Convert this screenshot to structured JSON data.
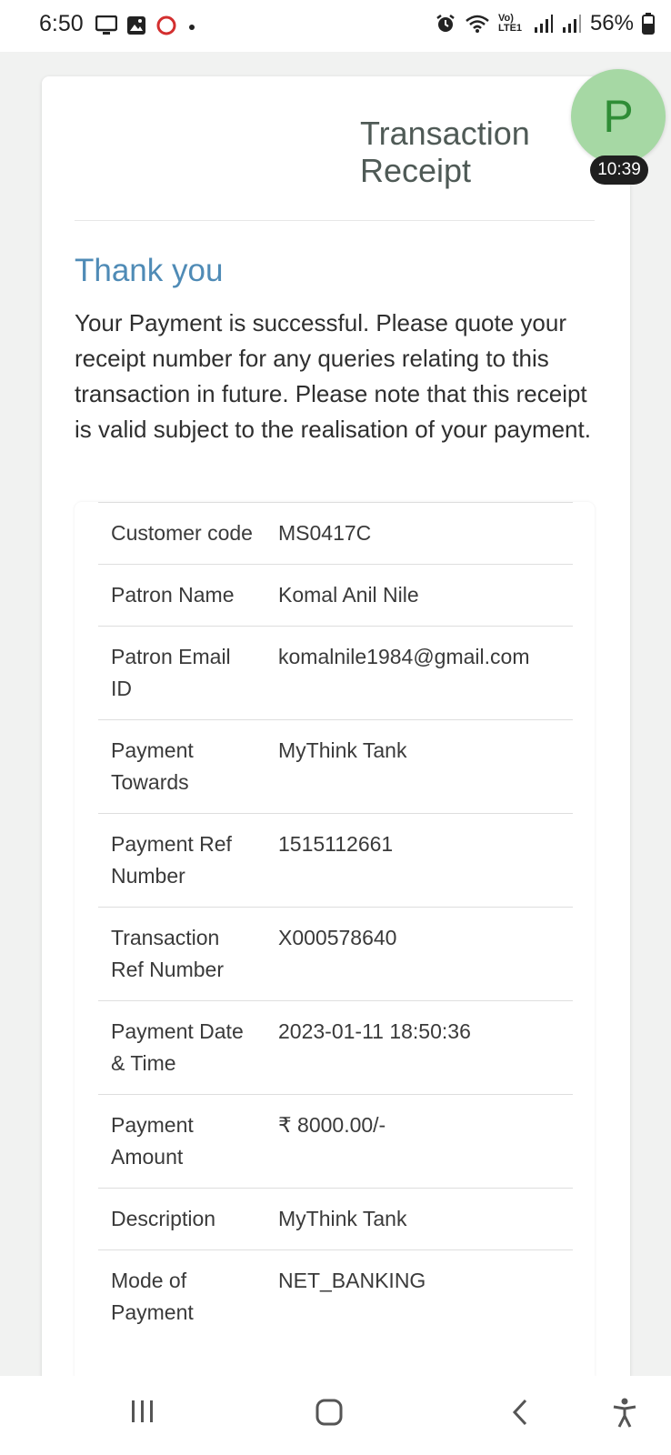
{
  "status_bar": {
    "time": "6:50",
    "battery": "56%",
    "network_label": "Vo) LTE1"
  },
  "receipt": {
    "title": "Transaction Receipt",
    "heading": "Thank you",
    "message": "Your Payment is successful. Please quote your receipt number for any queries relating to this transaction in future. Please note that this receipt is valid subject to the realisation of your payment.",
    "rows": [
      {
        "label": "Customer code",
        "value": "MS0417C"
      },
      {
        "label": "Patron Name",
        "value": "Komal Anil Nile"
      },
      {
        "label": "Patron Email ID",
        "value": "komalnile1984@gmail.com"
      },
      {
        "label": "Payment Towards",
        "value": "MyThink Tank"
      },
      {
        "label": "Payment Ref Number",
        "value": "1515112661"
      },
      {
        "label": "Transaction Ref Number",
        "value": "X000578640"
      },
      {
        "label": "Payment Date & Time",
        "value": "2023-01-11 18:50:36"
      },
      {
        "label": "Payment Amount",
        "value": "₹ 8000.00/-"
      },
      {
        "label": "Description",
        "value": "MyThink Tank"
      },
      {
        "label": "Mode of Payment",
        "value": "NET_BANKING"
      }
    ]
  },
  "overlay": {
    "avatar_letter": "P",
    "timer": "10:39"
  },
  "colors": {
    "heading": "#4f8bb6",
    "avatar_bg": "#a6d8a4",
    "avatar_fg": "#2f8d36"
  }
}
